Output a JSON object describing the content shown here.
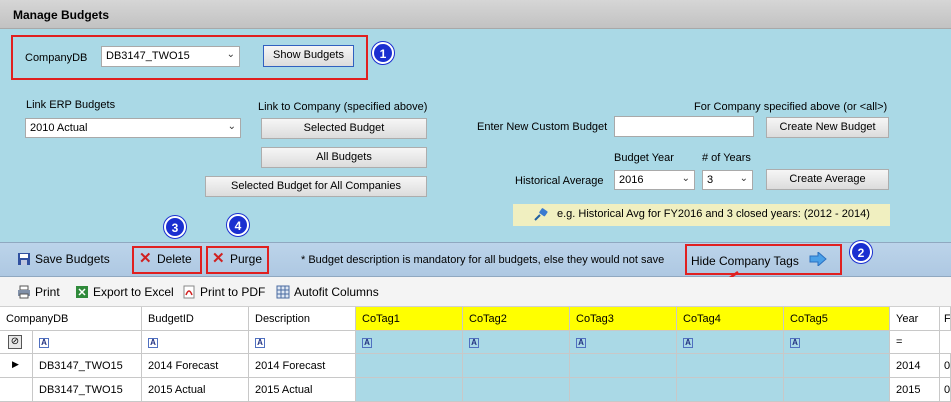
{
  "title": "Manage Budgets",
  "company": {
    "label": "CompanyDB",
    "value": "DB3147_TWO15",
    "show_button": "Show Budgets"
  },
  "markers": [
    "1",
    "2",
    "3",
    "4"
  ],
  "link_erp": {
    "label": "Link ERP Budgets",
    "value": "2010 Actual"
  },
  "link_company": {
    "label": "Link to Company (specified above)",
    "selected_budget": "Selected Budget",
    "all_budgets": "All Budgets",
    "selected_all_companies": "Selected Budget for All Companies"
  },
  "custom": {
    "header": "For Company specified above (or <all>)",
    "label": "Enter New Custom Budget",
    "value": "",
    "create_button": "Create New Budget"
  },
  "historical": {
    "label": "Historical Average",
    "year_label": "Budget Year",
    "year_value": "2016",
    "years_label": "# of Years",
    "years_value": "3",
    "create_button": "Create Average"
  },
  "hint": "e.g. Historical Avg for FY2016 and 3 closed years: (2012 - 2014)",
  "toolbar": {
    "save": "Save Budgets",
    "delete": "Delete",
    "purge": "Purge",
    "note": "* Budget description is mandatory for all budgets, else they would not save",
    "hide_tags": "Hide Company Tags"
  },
  "toolbar2": {
    "print": "Print",
    "export": "Export to Excel",
    "pdf": "Print to PDF",
    "autofit": "Autofit Columns"
  },
  "grid": {
    "columns": [
      "CompanyDB",
      "BudgetID",
      "Description",
      "CoTag1",
      "CoTag2",
      "CoTag3",
      "CoTag4",
      "CoTag5",
      "Year",
      "F"
    ],
    "year_filter": "=",
    "rows": [
      [
        "DB3147_TWO15",
        "2014 Forecast",
        "2014 Forecast",
        "2014"
      ],
      [
        "DB3147_TWO15",
        "2015 Actual",
        "2015 Actual",
        "2015"
      ]
    ],
    "last_col_cells": [
      "0",
      "0"
    ]
  },
  "colors": {
    "panel": "#aad9e6",
    "tag_header": "#ffff00",
    "marker": "#1a2fd0",
    "highlight": "#e02020"
  }
}
